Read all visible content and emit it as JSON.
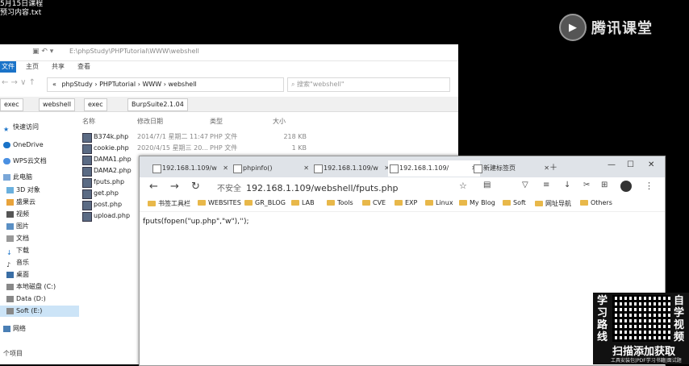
{
  "desktop": {
    "file_lines": [
      "5月15日课程",
      "预习内容.txt"
    ],
    "brand": "腾讯课堂"
  },
  "explorer": {
    "title_path": "E:\\phpStudy\\PHPTutorial\\WWW\\webshell",
    "ribbon": [
      "文件",
      "主页",
      "共享",
      "查看"
    ],
    "breadcrumb": [
      "«",
      "phpStudy",
      "PHPTutorial",
      "WWW",
      "webshell"
    ],
    "search_placeholder": "搜索\"webshell\"",
    "tabs": [
      "exec",
      "webshell",
      "exec",
      "BurpSuite2.1.04"
    ],
    "sidebar": [
      "快速访问",
      "OneDrive",
      "WPS云文档",
      "此电脑",
      "3D 对象",
      "盛果云",
      "视频",
      "图片",
      "文档",
      "下载",
      "音乐",
      "桌面",
      "本地磁盘 (C:)",
      "Data (D:)",
      "Soft (E:)",
      "网络"
    ],
    "columns": [
      "名称",
      "修改日期",
      "类型",
      "大小"
    ],
    "files": [
      {
        "name": "B374k.php",
        "date": "2014/7/1 星期二 11:47",
        "type": "PHP 文件",
        "size": "218 KB"
      },
      {
        "name": "cookie.php",
        "date": "2020/4/15 星期三 20...",
        "type": "PHP 文件",
        "size": "1 KB"
      },
      {
        "name": "DAMA1.php",
        "date": "",
        "type": "",
        "size": ""
      },
      {
        "name": "DAMA2.php",
        "date": "",
        "type": "",
        "size": ""
      },
      {
        "name": "fputs.php",
        "date": "",
        "type": "",
        "size": ""
      },
      {
        "name": "get.php",
        "date": "",
        "type": "",
        "size": ""
      },
      {
        "name": "post.php",
        "date": "",
        "type": "",
        "size": ""
      },
      {
        "name": "upload.php",
        "date": "",
        "type": "",
        "size": ""
      }
    ],
    "status": "个项目"
  },
  "browser": {
    "tabs": [
      "192.168.1.109/w",
      "phpinfo()",
      "192.168.1.109/w",
      "192.168.1.109/",
      "新建标签页"
    ],
    "url_security": "不安全",
    "url": "192.168.1.109/webshell/fputs.php",
    "bookmarks": [
      "书签工具栏",
      "WEBSITES",
      "GR_BLOG",
      "LAB",
      "Tools",
      "CVE",
      "EXP",
      "Linux",
      "My Blog",
      "Soft",
      "网址导航",
      "Others"
    ],
    "content": "fputs(fopen(\"up.php\",\"w\"),'');"
  },
  "promo": {
    "left": [
      "学",
      "习",
      "路",
      "线"
    ],
    "right": [
      "自",
      "学",
      "视",
      "频"
    ],
    "caption": "扫描添加获取",
    "sub": "工具安装包|PDF学习书籍|面试题"
  }
}
